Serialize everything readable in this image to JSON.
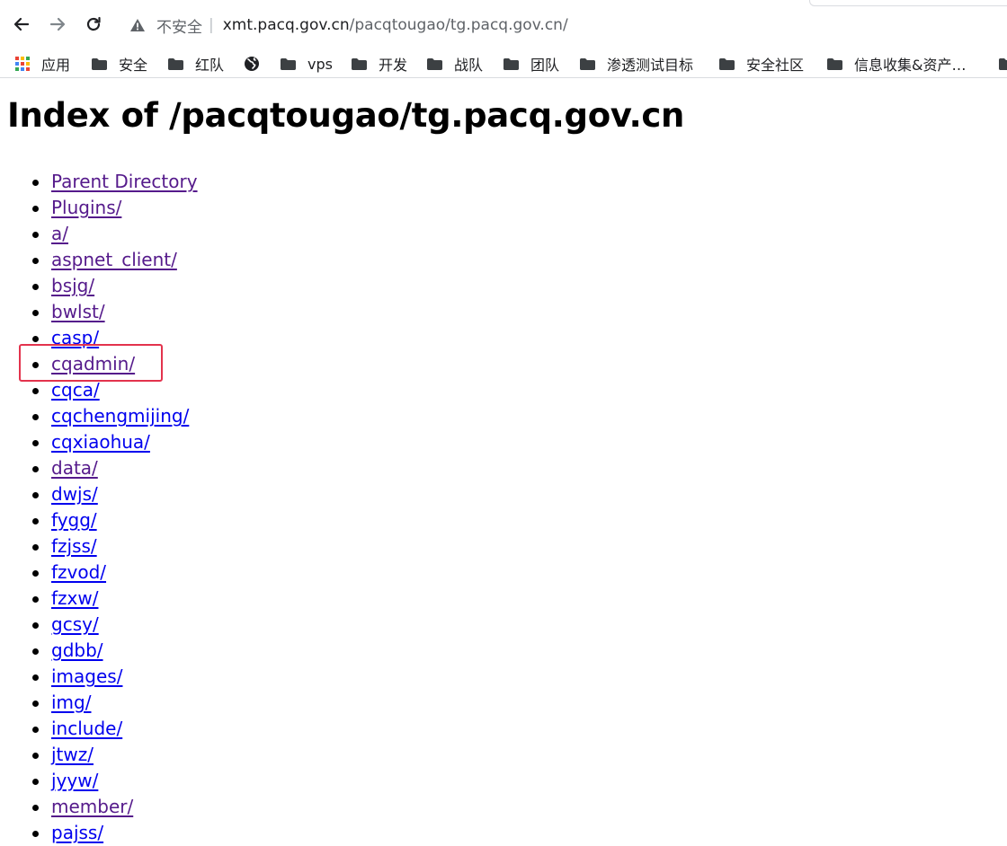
{
  "browser": {
    "security_label": "不安全",
    "separator": "|",
    "url_host": "xmt.pacq.gov.cn",
    "url_path": "/pacqtougao/tg.pacq.gov.cn/",
    "bookmarks": [
      {
        "label": "应用",
        "icon": "apps-grid-icon"
      },
      {
        "label": "安全",
        "icon": "folder-icon"
      },
      {
        "label": "红队",
        "icon": "folder-icon"
      },
      {
        "label": "",
        "icon": "globe-icon"
      },
      {
        "label": "vps",
        "icon": "folder-icon"
      },
      {
        "label": "开发",
        "icon": "folder-icon"
      },
      {
        "label": "战队",
        "icon": "folder-icon"
      },
      {
        "label": "团队",
        "icon": "folder-icon"
      },
      {
        "label": "渗透测试目标",
        "icon": "folder-icon"
      },
      {
        "label": "安全社区",
        "icon": "folder-icon"
      },
      {
        "label": "信息收集&资产…",
        "icon": "folder-icon"
      }
    ]
  },
  "page": {
    "title": "Index of /pacqtougao/tg.pacq.gov.cn",
    "entries": [
      {
        "label": "Parent Directory",
        "visited": true
      },
      {
        "label": "Plugins/",
        "visited": true
      },
      {
        "label": "a/",
        "visited": true
      },
      {
        "label": "aspnet_client/",
        "visited": true
      },
      {
        "label": "bsjg/",
        "visited": true
      },
      {
        "label": "bwlst/",
        "visited": true
      },
      {
        "label": "casp/",
        "visited": false
      },
      {
        "label": "cqadmin/",
        "visited": true
      },
      {
        "label": "cqca/",
        "visited": false
      },
      {
        "label": "cqchengmijing/",
        "visited": false
      },
      {
        "label": "cqxiaohua/",
        "visited": false
      },
      {
        "label": "data/",
        "visited": true
      },
      {
        "label": "dwjs/",
        "visited": false
      },
      {
        "label": "fygg/",
        "visited": false
      },
      {
        "label": "fzjss/",
        "visited": false
      },
      {
        "label": "fzvod/",
        "visited": false
      },
      {
        "label": "fzxw/",
        "visited": false
      },
      {
        "label": "gcsy/",
        "visited": false
      },
      {
        "label": "gdbb/",
        "visited": false
      },
      {
        "label": "images/",
        "visited": false
      },
      {
        "label": "img/",
        "visited": false
      },
      {
        "label": "include/",
        "visited": false
      },
      {
        "label": "jtwz/",
        "visited": false
      },
      {
        "label": "jyyw/",
        "visited": false
      },
      {
        "label": "member/",
        "visited": true
      },
      {
        "label": "pajss/",
        "visited": false
      }
    ],
    "highlight_color": "#e3334d",
    "visited_link_color": "#551a8b",
    "link_color": "#0000ee"
  }
}
